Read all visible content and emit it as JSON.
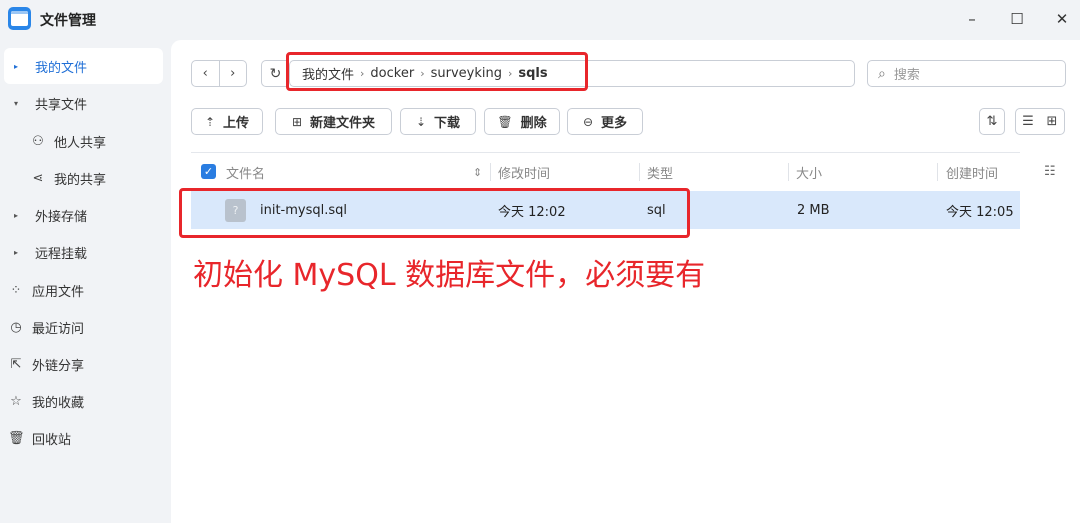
{
  "titlebar": {
    "title": "文件管理",
    "minimize_glyph": "–",
    "maximize_glyph": "☐",
    "close_glyph": "✕"
  },
  "sidebar": {
    "items": [
      {
        "label": "我的文件",
        "icon": "caret-right-icon",
        "glyph": "▸",
        "active": true
      },
      {
        "label": "共享文件",
        "icon": "caret-down-icon",
        "glyph": "▾",
        "active": false
      },
      {
        "label": "他人共享",
        "icon": "user-share-icon",
        "glyph": "⚇",
        "active": false
      },
      {
        "label": "我的共享",
        "icon": "share-nodes-icon",
        "glyph": "⋖",
        "active": false
      },
      {
        "label": "外接存储",
        "icon": "caret-right-icon",
        "glyph": "▸",
        "active": false
      },
      {
        "label": "远程挂载",
        "icon": "caret-right-icon",
        "glyph": "▸",
        "active": false
      },
      {
        "label": "应用文件",
        "icon": "apps-grid-icon",
        "glyph": "⁘",
        "active": false
      },
      {
        "label": "最近访问",
        "icon": "clock-icon",
        "glyph": "◷",
        "active": false
      },
      {
        "label": "外链分享",
        "icon": "external-link-icon",
        "glyph": "⇱",
        "active": false
      },
      {
        "label": "我的收藏",
        "icon": "star-icon",
        "glyph": "☆",
        "active": false
      },
      {
        "label": "回收站",
        "icon": "trash-icon",
        "glyph": "🗑",
        "active": false
      }
    ]
  },
  "nav": {
    "back_glyph": "‹",
    "forward_glyph": "›",
    "refresh_glyph": "↻"
  },
  "path": {
    "segments": [
      "我的文件",
      "docker",
      "surveyking",
      "sqls"
    ],
    "separator": "›"
  },
  "search": {
    "placeholder": "搜索",
    "icon": "search-icon",
    "glyph": "⌕"
  },
  "toolbar": {
    "upload": {
      "label": "上传",
      "icon": "upload-icon",
      "glyph": "⇡"
    },
    "new_folder": {
      "label": "新建文件夹",
      "icon": "new-folder-icon",
      "glyph": "⊞"
    },
    "download": {
      "label": "下载",
      "icon": "download-icon",
      "glyph": "⇣"
    },
    "delete": {
      "label": "删除",
      "icon": "trash-icon",
      "glyph": "🗑"
    },
    "more": {
      "label": "更多",
      "icon": "more-circle-icon",
      "glyph": "⊖"
    },
    "sort_glyph": "⇅",
    "list_view_glyph": "☰",
    "grid_view_glyph": "⊞"
  },
  "table": {
    "columns": {
      "name": "文件名",
      "modified": "修改时间",
      "type": "类型",
      "size": "大小",
      "created": "创建时间"
    },
    "sort_glyph": "⇕",
    "settings_glyph": "☷",
    "rows": [
      {
        "name": "init-mysql.sql",
        "modified": "今天 12:02",
        "type": "sql",
        "size": "2 MB",
        "created": "今天 12:05",
        "icon_glyph": "?"
      }
    ]
  },
  "annotation": {
    "text": "初始化 MySQL 数据库文件，必须要有",
    "color": "#e8262b"
  },
  "colors": {
    "accent": "#1f6fd6",
    "selected_row": "#d9e8fb",
    "highlight": "#e8262b"
  }
}
